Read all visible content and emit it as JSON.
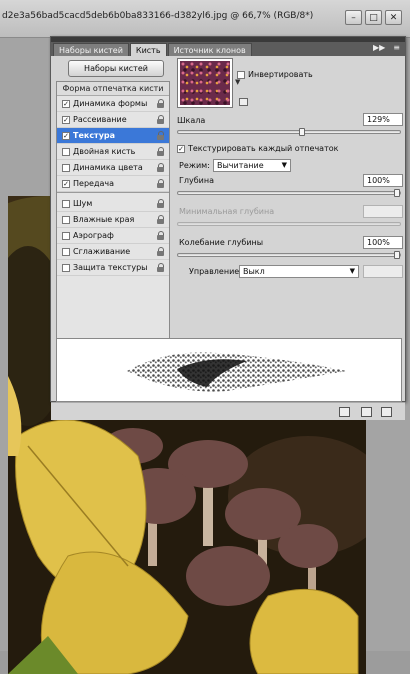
{
  "document": {
    "title": "d2e3a56bad5cacd5deb6b0ba833166-d382yl6.jpg @ 66,7% (RGB/8*)"
  },
  "window_buttons": [
    {
      "name": "minimize",
      "glyph": "–"
    },
    {
      "name": "restore",
      "glyph": "□"
    },
    {
      "name": "close",
      "glyph": "✕"
    }
  ],
  "panel": {
    "tabs": [
      {
        "label": "Наборы кистей",
        "active": false
      },
      {
        "label": "Кисть",
        "active": true
      },
      {
        "label": "Источник клонов",
        "active": false
      }
    ],
    "collapse_glyph": "▶▶",
    "menu_glyph": "≡",
    "presets_button": "Наборы кистей",
    "list_header": "Форма отпечатка кисти",
    "list_group_a": [
      {
        "label": "Динамика формы",
        "checked": true,
        "selected": false
      },
      {
        "label": "Рассеивание",
        "checked": true,
        "selected": false
      },
      {
        "label": "Текстура",
        "checked": true,
        "selected": true
      },
      {
        "label": "Двойная кисть",
        "checked": false,
        "selected": false
      },
      {
        "label": "Динамика цвета",
        "checked": false,
        "selected": false
      },
      {
        "label": "Передача",
        "checked": true,
        "selected": false
      }
    ],
    "list_group_b": [
      {
        "label": "Шум",
        "checked": false
      },
      {
        "label": "Влажные края",
        "checked": false
      },
      {
        "label": "Аэрограф",
        "checked": false
      },
      {
        "label": "Сглаживание",
        "checked": false
      },
      {
        "label": "Защита текстуры",
        "checked": false
      }
    ],
    "texture": {
      "invert_label": "Инвертировать",
      "invert_checked": false,
      "scale_label": "Шкала",
      "scale_value": "129%",
      "scale_level": 0.56,
      "texture_each_label": "Текстурировать каждый отпечаток",
      "texture_each_checked": true,
      "mode_label": "Режим:",
      "mode_value": "Вычитание",
      "depth_label": "Глубина",
      "depth_value": "100%",
      "depth_level": 1.0,
      "min_depth_label": "Минимальная глубина",
      "depth_jitter_label": "Колебание глубины",
      "depth_jitter_value": "100%",
      "depth_jitter_level": 1.0,
      "control_label": "Управление:",
      "control_value": "Выкл"
    }
  },
  "colors": {
    "selection_blue": "#3b78d8",
    "panel_gray": "#d4d4d4",
    "tab_bar": "#5c5c5c"
  }
}
